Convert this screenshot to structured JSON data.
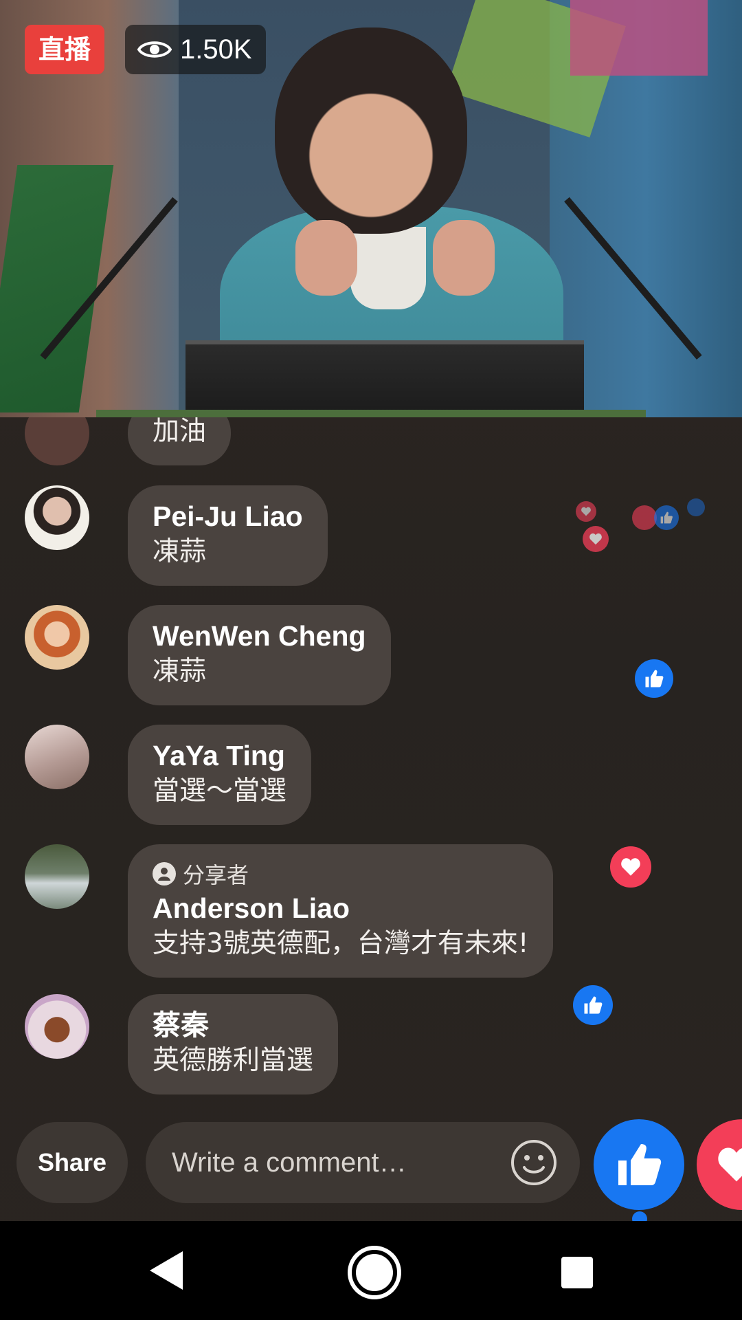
{
  "video": {
    "live_label": "直播",
    "viewer_count": "1.50K"
  },
  "comments": [
    {
      "name": "",
      "text": "加油"
    },
    {
      "name": "Pei-Ju Liao",
      "text": "凍蒜"
    },
    {
      "name": "WenWen Cheng",
      "text": "凍蒜"
    },
    {
      "name": "YaYa Ting",
      "text": "當選～當選"
    },
    {
      "sharer_label": "分享者",
      "name": "Anderson Liao",
      "text": "支持3號英德配，台灣才有未來!"
    },
    {
      "name": "蔡秦",
      "text": "英德勝利當選"
    }
  ],
  "bottom": {
    "share_label": "Share",
    "comment_placeholder": "Write a comment…"
  },
  "colors": {
    "like_blue": "#1877f2",
    "love_red": "#f33e58",
    "live_red": "#e9403c",
    "bubble": "#4a433f"
  }
}
